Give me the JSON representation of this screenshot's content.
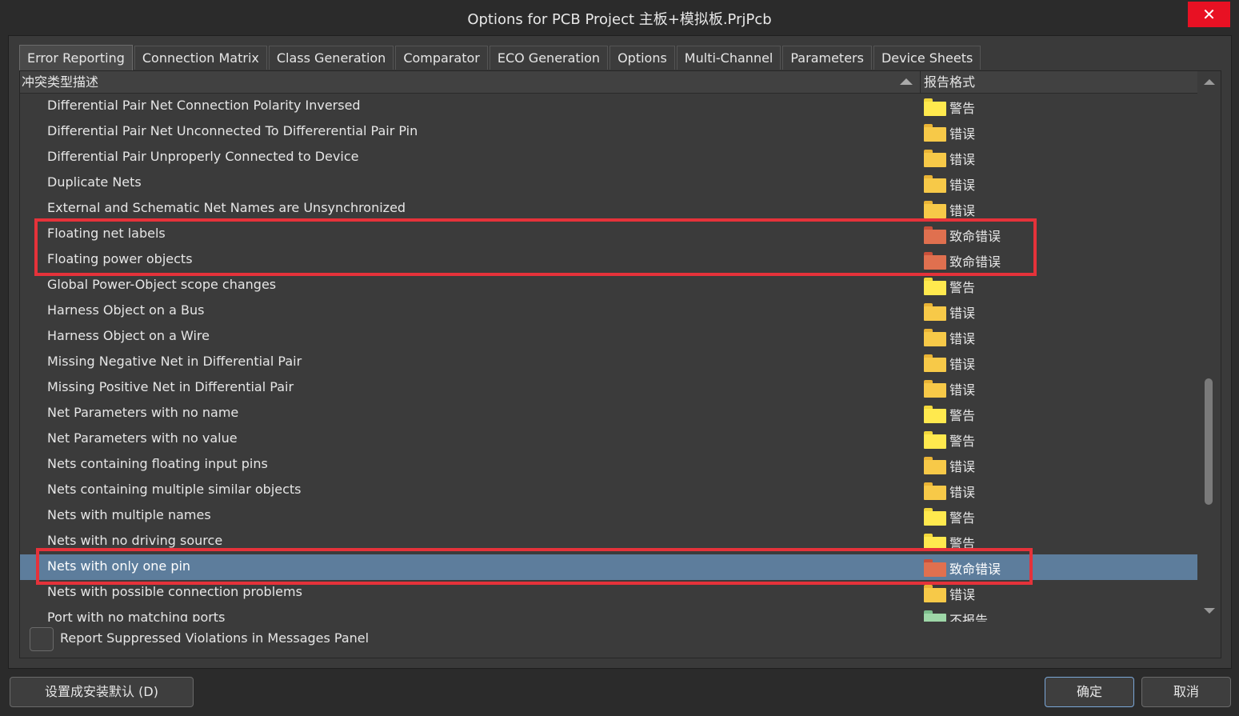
{
  "window": {
    "title": "Options for PCB Project 主板+模拟板.PrjPcb",
    "close": "✕"
  },
  "tabs": [
    "Error Reporting",
    "Connection Matrix",
    "Class Generation",
    "Comparator",
    "ECO Generation",
    "Options",
    "Multi-Channel",
    "Parameters",
    "Device Sheets"
  ],
  "active_tab": "Error Reporting",
  "table": {
    "col_desc": "冲突类型描述",
    "col_format": "报告格式",
    "rows": [
      {
        "desc": "Differential Pair Net Connection Polarity Inversed",
        "format": "警告",
        "level": "warning"
      },
      {
        "desc": "Differential Pair Net Unconnected To Differerential Pair Pin",
        "format": "错误",
        "level": "error"
      },
      {
        "desc": "Differential Pair Unproperly Connected to Device",
        "format": "错误",
        "level": "error"
      },
      {
        "desc": "Duplicate Nets",
        "format": "错误",
        "level": "error"
      },
      {
        "desc": "External and Schematic Net Names are Unsynchronized",
        "format": "错误",
        "level": "error"
      },
      {
        "desc": "Floating net labels",
        "format": "致命错误",
        "level": "fatal"
      },
      {
        "desc": "Floating power objects",
        "format": "致命错误",
        "level": "fatal"
      },
      {
        "desc": "Global Power-Object scope changes",
        "format": "警告",
        "level": "warning"
      },
      {
        "desc": "Harness Object on a Bus",
        "format": "错误",
        "level": "error"
      },
      {
        "desc": "Harness Object on a Wire",
        "format": "错误",
        "level": "error"
      },
      {
        "desc": "Missing Negative Net in Differential Pair",
        "format": "错误",
        "level": "error"
      },
      {
        "desc": "Missing Positive Net in Differential Pair",
        "format": "错误",
        "level": "error"
      },
      {
        "desc": "Net Parameters with no name",
        "format": "警告",
        "level": "warning"
      },
      {
        "desc": "Net Parameters with no value",
        "format": "警告",
        "level": "warning"
      },
      {
        "desc": "Nets containing floating input pins",
        "format": "错误",
        "level": "error"
      },
      {
        "desc": "Nets containing multiple similar objects",
        "format": "错误",
        "level": "error"
      },
      {
        "desc": "Nets with multiple names",
        "format": "警告",
        "level": "warning"
      },
      {
        "desc": "Nets with no driving source",
        "format": "警告",
        "level": "warning"
      },
      {
        "desc": "Nets with only one pin",
        "format": "致命错误",
        "level": "fatal",
        "selected": true
      },
      {
        "desc": "Nets with possible connection problems",
        "format": "错误",
        "level": "error"
      },
      {
        "desc": "Port with no matching ports",
        "format": "不报告",
        "level": "none"
      }
    ]
  },
  "level_colors": {
    "warning": {
      "tab": "#f2d73b",
      "body": "#ffe94e"
    },
    "error": {
      "tab": "#e9b335",
      "body": "#f7c948"
    },
    "fatal": {
      "tab": "#c9503a",
      "body": "#e0704f"
    },
    "none": {
      "tab": "#7dbd8c",
      "body": "#9ed7a8"
    }
  },
  "checkbox": {
    "label": "Report Suppressed Violations in Messages Panel",
    "checked": false
  },
  "buttons": {
    "defaults": "设置成安装默认 (D)",
    "ok": "确定",
    "cancel": "取消"
  },
  "highlight_color": "#e5323a",
  "selection_color": "#5d7d9c"
}
